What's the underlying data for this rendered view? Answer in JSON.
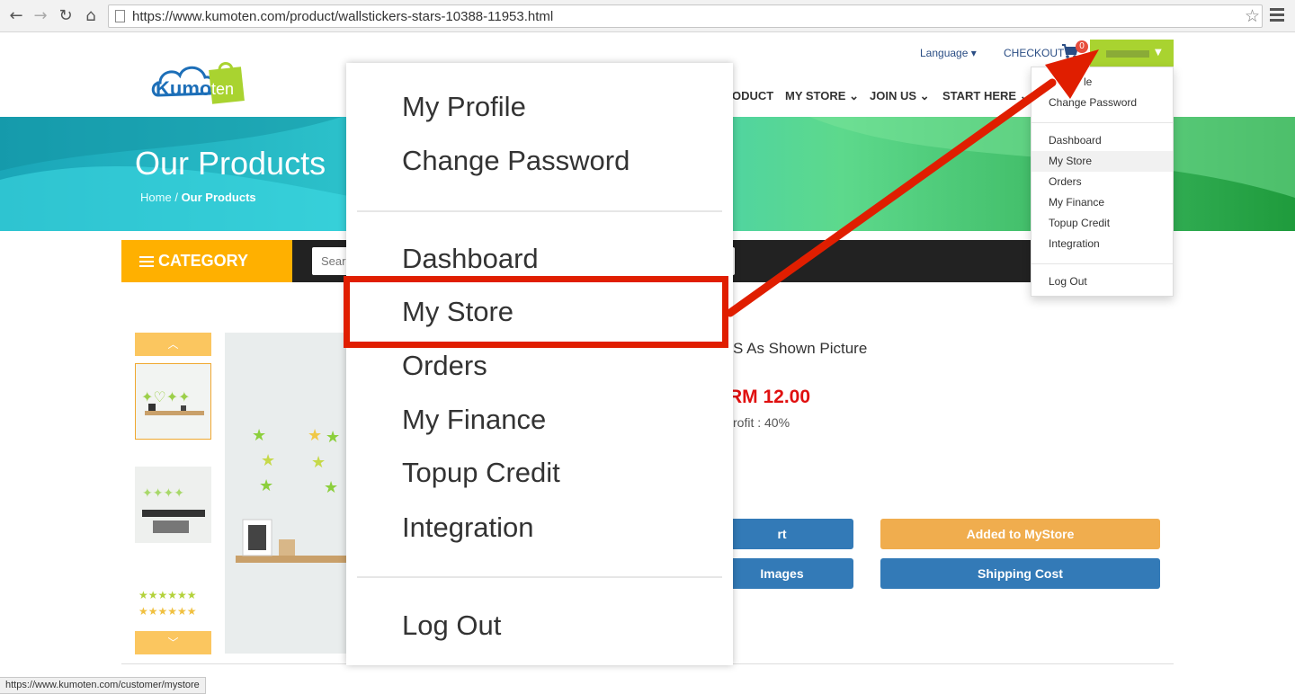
{
  "browser": {
    "url": "https://www.kumoten.com/product/wallstickers-stars-10388-11953.html",
    "status_url": "https://www.kumoten.com/customer/mystore"
  },
  "logo": {
    "text_part1": "Kumo",
    "text_part2": "ten"
  },
  "header": {
    "language_label": "Language",
    "checkout_label": "CHECKOUT",
    "cart_count": "0",
    "nav": [
      {
        "label": "ODUCT"
      },
      {
        "label": "MY STORE"
      },
      {
        "label": "JOIN US"
      },
      {
        "label": "START HERE"
      }
    ]
  },
  "hero": {
    "title": "Our Products",
    "breadcrumb_home": "Home",
    "breadcrumb_sep": "/",
    "breadcrumb_current": "Our Products"
  },
  "category": {
    "label": "CATEGORY"
  },
  "search": {
    "placeholder": "Sear"
  },
  "product": {
    "title_fragment": "S As Shown Picture",
    "price": "RM 12.00",
    "profit": "rofit : 40%"
  },
  "buttons": {
    "cart_fragment": "rt",
    "added_store": "Added to MyStore",
    "images_fragment": "Images",
    "shipping": "Shipping Cost"
  },
  "user_dropdown": {
    "items": [
      {
        "label": "le"
      },
      {
        "label": "Change Password"
      },
      {
        "label": "Dashboard"
      },
      {
        "label": "My Store"
      },
      {
        "label": "Orders"
      },
      {
        "label": "My Finance"
      },
      {
        "label": "Topup Credit"
      },
      {
        "label": "Integration"
      },
      {
        "label": "Log Out"
      }
    ]
  },
  "zoom_menu": {
    "items": [
      {
        "label": "My Profile"
      },
      {
        "label": "Change Password"
      },
      {
        "label": "Dashboard"
      },
      {
        "label": "My Store"
      },
      {
        "label": "Orders"
      },
      {
        "label": "My Finance"
      },
      {
        "label": "Topup Credit"
      },
      {
        "label": "Integration"
      },
      {
        "label": "Log Out"
      }
    ]
  },
  "colors": {
    "brand_green": "#a9d330",
    "category_orange": "#ffb000",
    "button_blue": "#337ab7",
    "button_orange": "#f0ad4e",
    "price_red": "#e01010",
    "annotation_red": "#e01e00"
  },
  "icons": {
    "back": "back-arrow-icon",
    "forward": "forward-arrow-icon",
    "reload": "reload-icon",
    "home": "home-icon",
    "bookmark": "star-icon",
    "menu": "hamburger-icon",
    "cart": "cart-icon"
  }
}
